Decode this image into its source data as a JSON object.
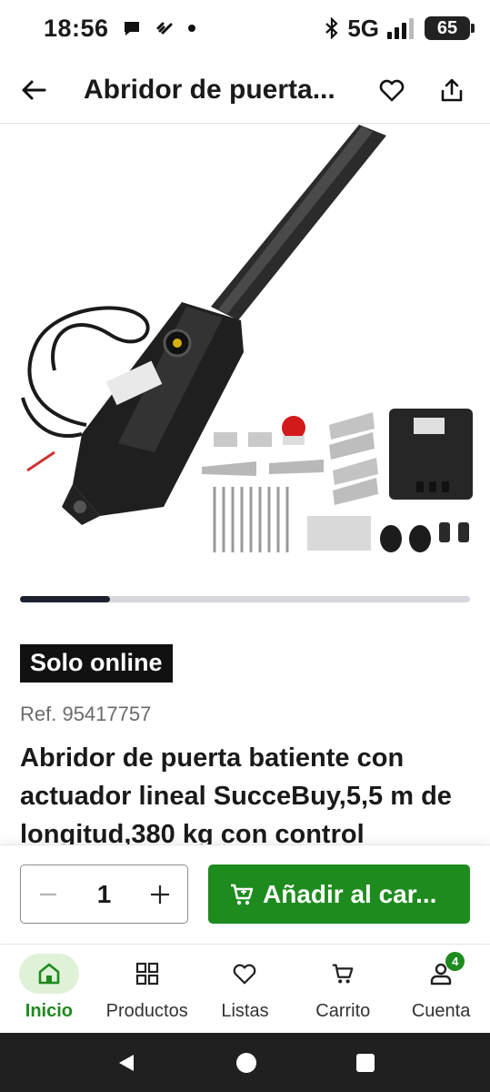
{
  "status": {
    "time": "18:56",
    "network": "5G",
    "battery": "65"
  },
  "header": {
    "title": "Abridor de puerta..."
  },
  "product": {
    "badge": "Solo online",
    "ref": "Ref. 95417757",
    "title": "Abridor de puerta batiente con actuador lineal SucceBuy,5,5 m de longitud,380 kg con control"
  },
  "carousel": {
    "current": 1,
    "total": 5
  },
  "purchase": {
    "quantity": "1",
    "add_label": "Añadir al car..."
  },
  "nav": {
    "items": [
      {
        "label": "Inicio",
        "icon": "home-icon",
        "active": true
      },
      {
        "label": "Productos",
        "icon": "grid-icon"
      },
      {
        "label": "Listas",
        "icon": "heart-icon"
      },
      {
        "label": "Carrito",
        "icon": "cart-icon"
      },
      {
        "label": "Cuenta",
        "icon": "user-icon",
        "badge": "4"
      }
    ]
  },
  "colors": {
    "accent": "#1e8b1e",
    "active_bg": "#dff2d8",
    "badge_bg": "#111111"
  }
}
